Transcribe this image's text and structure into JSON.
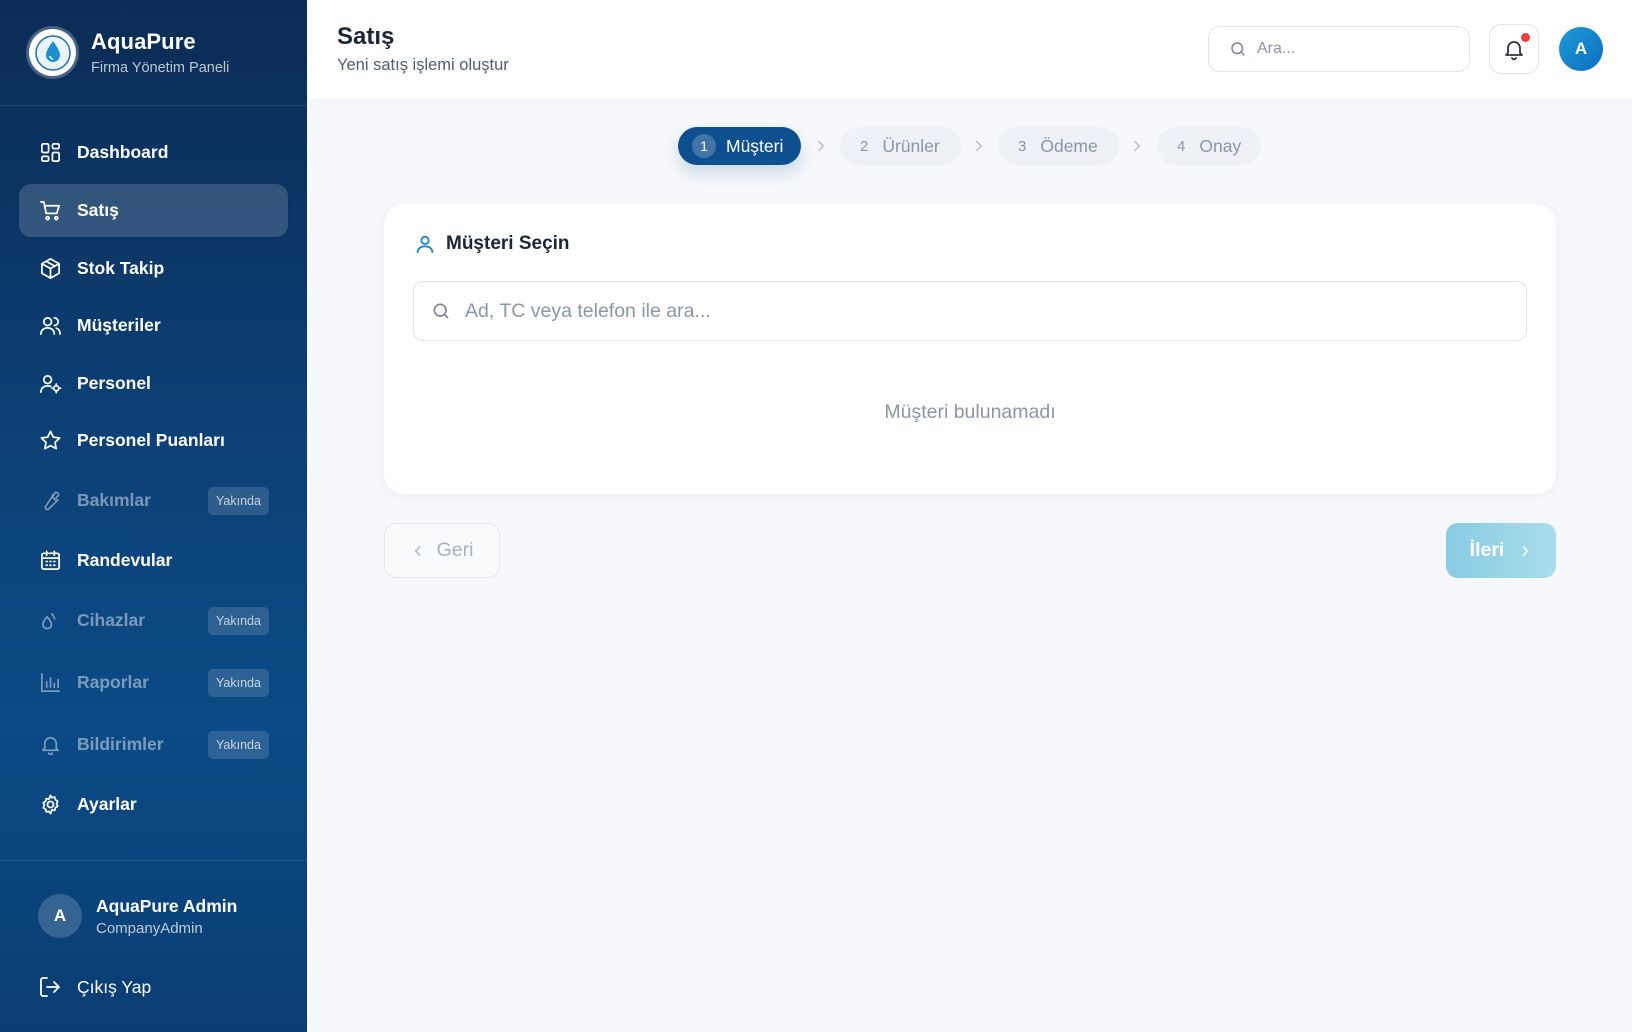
{
  "brand": {
    "name": "AquaPure",
    "subtitle": "Firma Yönetim Paneli",
    "logo_icon": "water-drop-logo"
  },
  "sidebar": {
    "items": [
      {
        "label": "Dashboard",
        "icon": "dashboard-icon",
        "active": false,
        "disabled": false
      },
      {
        "label": "Satış",
        "icon": "cart-icon",
        "active": true,
        "disabled": false
      },
      {
        "label": "Stok Takip",
        "icon": "package-icon",
        "active": false,
        "disabled": false
      },
      {
        "label": "Müşteriler",
        "icon": "users-icon",
        "active": false,
        "disabled": false
      },
      {
        "label": "Personel",
        "icon": "user-gear-icon",
        "active": false,
        "disabled": false
      },
      {
        "label": "Personel Puanları",
        "icon": "star-icon",
        "active": false,
        "disabled": false
      },
      {
        "label": "Bakımlar",
        "icon": "wrench-icon",
        "active": false,
        "disabled": true,
        "badge": "Yakında"
      },
      {
        "label": "Randevular",
        "icon": "calendar-icon",
        "active": false,
        "disabled": false
      },
      {
        "label": "Cihazlar",
        "icon": "droplets-icon",
        "active": false,
        "disabled": true,
        "badge": "Yakında"
      },
      {
        "label": "Raporlar",
        "icon": "bar-chart-icon",
        "active": false,
        "disabled": true,
        "badge": "Yakında"
      },
      {
        "label": "Bildirimler",
        "icon": "bell-icon",
        "active": false,
        "disabled": true,
        "badge": "Yakında"
      },
      {
        "label": "Ayarlar",
        "icon": "gear-icon",
        "active": false,
        "disabled": false
      }
    ],
    "user": {
      "initial": "A",
      "name": "AquaPure Admin",
      "role": "CompanyAdmin"
    },
    "logout_label": "Çıkış Yap"
  },
  "header": {
    "title": "Satış",
    "subtitle": "Yeni satış işlemi oluştur",
    "search_placeholder": "Ara...",
    "avatar_initial": "A",
    "has_notification": true
  },
  "stepper": {
    "steps": [
      {
        "num": "1",
        "label": "Müşteri",
        "active": true
      },
      {
        "num": "2",
        "label": "Ürünler",
        "active": false
      },
      {
        "num": "3",
        "label": "Ödeme",
        "active": false
      },
      {
        "num": "4",
        "label": "Onay",
        "active": false
      }
    ]
  },
  "customer_card": {
    "title": "Müşteri Seçin",
    "search_placeholder": "Ad, TC veya telefon ile ara...",
    "empty_text": "Müşteri bulunamadı"
  },
  "actions": {
    "back_label": "Geri",
    "next_label": "İleri"
  },
  "colors": {
    "sidebar": "#0c4178",
    "accent": "#0d4f8f",
    "next_button": "#88cbe3",
    "notification_dot": "#ef3b3b"
  }
}
